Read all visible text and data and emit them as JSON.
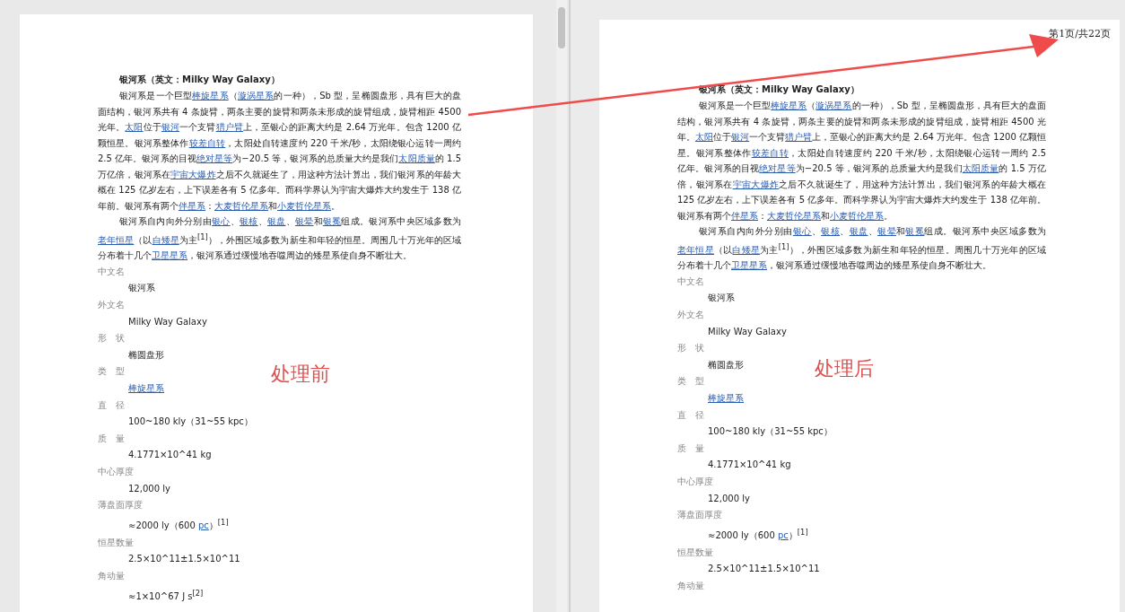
{
  "pages": [
    {
      "annotation": "处理前",
      "heading": "银河系（英文：Milky Way Galaxy）",
      "paragraphs": [
        [
          {
            "t": "银河系是一个巨型",
            "link": false
          },
          {
            "t": "棒旋星系",
            "link": true
          },
          {
            "t": "（",
            "link": false
          },
          {
            "t": "漩涡星系",
            "link": true
          },
          {
            "t": "的一种），Sb 型，呈椭圆盘形，具有巨大的盘面结构，银河系共有 4 条旋臂，两条主要的旋臂和两条未形成的旋臂组成，旋臂相距 4500 光年。",
            "link": false
          },
          {
            "t": "太阳",
            "link": true
          },
          {
            "t": "位于",
            "link": false
          },
          {
            "t": "银河",
            "link": true
          },
          {
            "t": "一个支臂",
            "link": false
          },
          {
            "t": "猎户臂",
            "link": true
          },
          {
            "t": "上，至银心的距离大约是 2.64 万光年。包含 1200 亿颗恒星。银河系整体作",
            "link": false
          },
          {
            "t": "较差自转",
            "link": true
          },
          {
            "t": "，太阳处自转速度约 220 千米/秒，太阳绕银心运转一周约 2.5 亿年。银河系的目视",
            "link": false
          },
          {
            "t": "绝对星等",
            "link": true
          },
          {
            "t": "为−20.5 等，银河系的总质量大约是我们",
            "link": false
          },
          {
            "t": "太阳质量",
            "link": true
          },
          {
            "t": "的 1.5 万亿倍，银河系在",
            "link": false
          },
          {
            "t": "宇宙大爆炸",
            "link": true
          },
          {
            "t": "之后不久就诞生了，用这种方法计算出，我们银河系的年龄大概在 125 亿岁左右，上下误差各有 5 亿多年。而科学界认为宇宙大爆炸大约发生于 138 亿年前。银河系有两个",
            "link": false
          },
          {
            "t": "伴星系",
            "link": true
          },
          {
            "t": "：",
            "link": false
          },
          {
            "t": "大麦哲伦星系",
            "link": true
          },
          {
            "t": "和",
            "link": false
          },
          {
            "t": "小麦哲伦星系",
            "link": true
          },
          {
            "t": "。",
            "link": false
          }
        ],
        [
          {
            "t": "银河系自内向外分别由",
            "link": false
          },
          {
            "t": "银心",
            "link": true
          },
          {
            "t": "、",
            "link": false
          },
          {
            "t": "银核",
            "link": true
          },
          {
            "t": "、",
            "link": false
          },
          {
            "t": "银盘",
            "link": true
          },
          {
            "t": "、",
            "link": false
          },
          {
            "t": "银晕",
            "link": true
          },
          {
            "t": "和",
            "link": false
          },
          {
            "t": "银冕",
            "link": true
          },
          {
            "t": "组成。银河系中央区域多数为",
            "link": false
          },
          {
            "t": "老年恒星",
            "link": true
          },
          {
            "t": "（以",
            "link": false
          },
          {
            "t": "白矮星",
            "link": true
          },
          {
            "t": "为主$^{[1]}$），外围区域多数为新生和年轻的恒星。周围几十万光年的区域分布着十几个",
            "link": false
          },
          {
            "t": "卫星星系",
            "link": true
          },
          {
            "t": "，银河系通过缓慢地吞噬周边的矮星系使自身不断壮大。",
            "link": false
          }
        ]
      ],
      "infobox": [
        {
          "label": "中文名",
          "value": [
            {
              "t": "银河系",
              "link": false
            }
          ]
        },
        {
          "label": "外文名",
          "value": [
            {
              "t": "Milky Way Galaxy",
              "link": false
            }
          ]
        },
        {
          "label": "形　状",
          "value": [
            {
              "t": "椭圆盘形",
              "link": false
            }
          ]
        },
        {
          "label": "类　型",
          "value": [
            {
              "t": "棒旋星系",
              "link": true
            }
          ]
        },
        {
          "label": "直　径",
          "value": [
            {
              "t": "100~180 kly（31~55 kpc）",
              "link": false
            }
          ]
        },
        {
          "label": "质　量",
          "value": [
            {
              "t": "4.1771×10^41 kg",
              "link": false
            }
          ]
        },
        {
          "label": "中心厚度",
          "value": [
            {
              "t": "12,000 ly",
              "link": false
            }
          ]
        },
        {
          "label": "薄盘面厚度",
          "value": [
            {
              "t": "≈2000 ly（600 ",
              "link": false
            },
            {
              "t": "pc",
              "link": true
            },
            {
              "t": "）$^{[1]}$",
              "link": false
            }
          ]
        },
        {
          "label": "恒星数量",
          "value": [
            {
              "t": "2.5×10^11±1.5×10^11",
              "link": false
            }
          ]
        },
        {
          "label": "角动量",
          "value": [
            {
              "t": "≈1×10^67 J s$^{[2]}$",
              "link": false
            }
          ]
        }
      ]
    },
    {
      "annotation": "处理后",
      "page_counter": "第1页/共22页",
      "heading": "银河系（英文：Milky Way Galaxy）",
      "paragraphs": [
        [
          {
            "t": "银河系是一个巨型",
            "link": false
          },
          {
            "t": "棒旋星系",
            "link": true
          },
          {
            "t": "（",
            "link": false
          },
          {
            "t": "漩涡星系",
            "link": true
          },
          {
            "t": "的一种），Sb 型，呈椭圆盘形，具有巨大的盘面结构，银河系共有 4 条旋臂，两条主要的旋臂和两条未形成的旋臂组成，旋臂相距 4500 光年。",
            "link": false
          },
          {
            "t": "太阳",
            "link": true
          },
          {
            "t": "位于",
            "link": false
          },
          {
            "t": "银河",
            "link": true
          },
          {
            "t": "一个支臂",
            "link": false
          },
          {
            "t": "猎户臂",
            "link": true
          },
          {
            "t": "上，至银心的距离大约是 2.64 万光年。包含 1200 亿颗恒星。银河系整体作",
            "link": false
          },
          {
            "t": "较差自转",
            "link": true
          },
          {
            "t": "，太阳处自转速度约 220 千米/秒，太阳绕银心运转一周约 2.5 亿年。银河系的目视",
            "link": false
          },
          {
            "t": "绝对星等",
            "link": true
          },
          {
            "t": "为−20.5 等，银河系的总质量大约是我们",
            "link": false
          },
          {
            "t": "太阳质量",
            "link": true
          },
          {
            "t": "的 1.5 万亿倍，银河系在",
            "link": false
          },
          {
            "t": "宇宙大爆炸",
            "link": true
          },
          {
            "t": "之后不久就诞生了，用这种方法计算出，我们银河系的年龄大概在 125 亿岁左右，上下误差各有 5 亿多年。而科学界认为宇宙大爆炸大约发生于 138 亿年前。银河系有两个",
            "link": false
          },
          {
            "t": "伴星系",
            "link": true
          },
          {
            "t": "：",
            "link": false
          },
          {
            "t": "大麦哲伦星系",
            "link": true
          },
          {
            "t": "和",
            "link": false
          },
          {
            "t": "小麦哲伦星系",
            "link": true
          },
          {
            "t": "。",
            "link": false
          }
        ],
        [
          {
            "t": "银河系自内向外分别由",
            "link": false
          },
          {
            "t": "银心",
            "link": true
          },
          {
            "t": "、",
            "link": false
          },
          {
            "t": "银核",
            "link": true
          },
          {
            "t": "、",
            "link": false
          },
          {
            "t": "银盘",
            "link": true
          },
          {
            "t": "、",
            "link": false
          },
          {
            "t": "银晕",
            "link": true
          },
          {
            "t": "和",
            "link": false
          },
          {
            "t": "银冕",
            "link": true
          },
          {
            "t": "组成。银河系中央区域多数为",
            "link": false
          },
          {
            "t": "老年恒星",
            "link": true
          },
          {
            "t": "（以",
            "link": false
          },
          {
            "t": "白矮星",
            "link": true
          },
          {
            "t": "为主$^{[1]}$），外围区域多数为新生和年轻的恒星。周围几十万光年的区域分布着十几个",
            "link": false
          },
          {
            "t": "卫星星系",
            "link": true
          },
          {
            "t": "，银河系通过缓慢地吞噬周边的矮星系使自身不断壮大。",
            "link": false
          }
        ]
      ],
      "infobox": [
        {
          "label": "中文名",
          "value": [
            {
              "t": "银河系",
              "link": false
            }
          ]
        },
        {
          "label": "外文名",
          "value": [
            {
              "t": "Milky Way Galaxy",
              "link": false
            }
          ]
        },
        {
          "label": "形　状",
          "value": [
            {
              "t": "椭圆盘形",
              "link": false
            }
          ]
        },
        {
          "label": "类　型",
          "value": [
            {
              "t": "棒旋星系",
              "link": true
            }
          ]
        },
        {
          "label": "直　径",
          "value": [
            {
              "t": "100~180 kly（31~55 kpc）",
              "link": false
            }
          ]
        },
        {
          "label": "质　量",
          "value": [
            {
              "t": "4.1771×10^41 kg",
              "link": false
            }
          ]
        },
        {
          "label": "中心厚度",
          "value": [
            {
              "t": "12,000 ly",
              "link": false
            }
          ]
        },
        {
          "label": "薄盘面厚度",
          "value": [
            {
              "t": "≈2000 ly（600 ",
              "link": false
            },
            {
              "t": "pc",
              "link": true
            },
            {
              "t": "）$^{[1]}$",
              "link": false
            }
          ]
        },
        {
          "label": "恒星数量",
          "value": [
            {
              "t": "2.5×10^11±1.5×10^11",
              "link": false
            }
          ]
        },
        {
          "label": "角动量"
        }
      ]
    }
  ]
}
